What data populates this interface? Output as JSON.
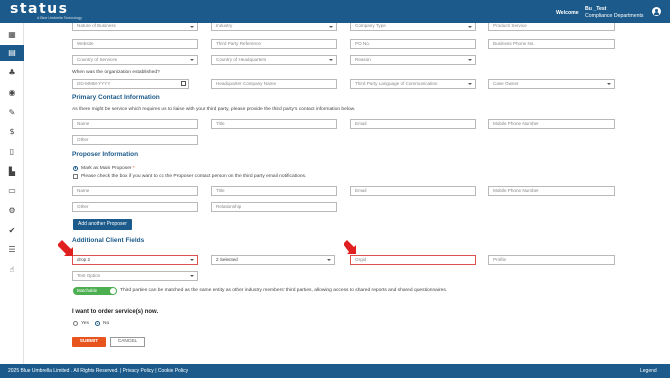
{
  "header": {
    "logo": "status",
    "tagline": "A Blue Umbrella Technology",
    "welcome": "Welcome",
    "username": "Bu _Test",
    "department": "Compliance Departments"
  },
  "sidebar": {
    "icons": [
      "table-icon",
      "building-icon",
      "bell-icon",
      "eye-icon",
      "edit-icon",
      "dollar-icon",
      "document-icon",
      "chart-icon",
      "briefcase-icon",
      "gear-icon",
      "user-check-icon",
      "list-icon",
      "hand-icon"
    ]
  },
  "org": {
    "row0": [
      "Nature of Business",
      "Industry",
      "Company Type",
      "Product/ Service"
    ],
    "row1": [
      "Website",
      "Third Party Reference",
      "PO No.",
      "Business Phone No."
    ],
    "row2": [
      "Country of Services",
      "Country of Headquarters",
      "Reason",
      ""
    ],
    "established_question": "When was the organization established?",
    "date_placeholder": "DD-MMM-YYYY",
    "row3": [
      "Headquarter Company Name",
      "Third Party Language of Communication",
      "Case Owner"
    ]
  },
  "primary_contact": {
    "title": "Primary Contact Information",
    "description": "As there might be service which requires us to liaise with your third party, please provide the third party's contact information below.",
    "fields": [
      "Name",
      "Title",
      "Email",
      "Mobile Phone Number"
    ],
    "other": "Other"
  },
  "proposer": {
    "title": "Proposer Information",
    "mark_main": "Mark as Main Proposer",
    "required_star": "*",
    "cc_text": "Please check the box if you want to cc the Proposer contact person on the third party email notifications.",
    "fields": [
      "Name",
      "Title",
      "Email",
      "Mobile Phone Number"
    ],
    "other": "Other",
    "relationship": "Relationship",
    "add_button": "Add another Proposer"
  },
  "client_fields": {
    "title": "Additional Client Fields",
    "drop2": "drop 2",
    "selected": "2 Selected",
    "orgid": "Orgid",
    "profile": "Profile",
    "test_option": "Test Option"
  },
  "matchable": {
    "label": "Matchable",
    "description": "Third parties can be matched as the same entity as other industry members' third parties, allowing access to shared reports and shared questionnaires."
  },
  "order": {
    "question": "I want to order service(s) now.",
    "yes": "Yes",
    "no": "No",
    "selected": "No"
  },
  "actions": {
    "submit": "SUBMIT",
    "cancel": "CANCEL"
  },
  "footer": {
    "text": "2025 Blue Umbrella Limited . All Rights Reserved. | Privacy Policy | Cookie Policy",
    "legend": "Legend"
  },
  "colors": {
    "primary": "#1b5a8a",
    "accent": "#e8541e",
    "error": "#d9534f",
    "toggle": "#4caf50",
    "arrow": "#e02020"
  }
}
